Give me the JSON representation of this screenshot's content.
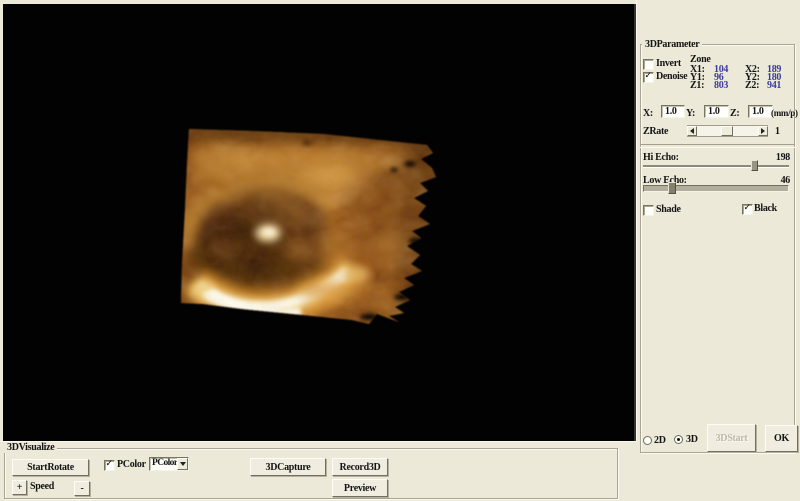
{
  "colors": {
    "panel": "#ece9d8",
    "value_blue": "#3c3c9e",
    "canvas": "#020202"
  },
  "parameter_panel": {
    "title": "3DParameter",
    "invert": {
      "label": "Invert",
      "checked": false
    },
    "denoise": {
      "label": "Denoise",
      "checked": true
    },
    "zone": {
      "label": "Zone",
      "rows": [
        {
          "l1": "X1:",
          "v1": "104",
          "l2": "X2:",
          "v2": "189"
        },
        {
          "l1": "Y1:",
          "v1": "96",
          "l2": "Y2:",
          "v2": "180"
        },
        {
          "l1": "Z1:",
          "v1": "803",
          "l2": "Z2:",
          "v2": "941"
        }
      ]
    },
    "scale": {
      "x_label": "X:",
      "x_value": "1.0",
      "y_label": "Y:",
      "y_value": "1.0",
      "z_label": "Z:",
      "z_value": "1.0",
      "unit": "(mm/p)"
    },
    "zrate": {
      "label": "ZRate",
      "value": "1"
    },
    "hi_echo": {
      "label": "Hi Echo:",
      "value": 198,
      "max": 255
    },
    "low_echo": {
      "label": "Low Echo:",
      "value": 46,
      "max": 255
    },
    "shade": {
      "label": "Shade",
      "checked": false
    },
    "black": {
      "label": "Black",
      "checked": true
    },
    "mode_2d": {
      "label": "2D",
      "selected": false
    },
    "mode_3d": {
      "label": "3D",
      "selected": true
    },
    "start_button_label": "3DStart",
    "ok_button_label": "OK"
  },
  "visualize_panel": {
    "title": "3DVisualize",
    "start_rotate_label": "StartRotate",
    "speed_plus_label": "+",
    "speed_label": "Speed",
    "speed_minus_label": "-",
    "pcolor": {
      "label": "PColor",
      "checked": true
    },
    "pcolor_combo_value": "PColor",
    "capture_label": "3DCapture",
    "record_label": "Record3D",
    "preview_label": "Preview"
  }
}
